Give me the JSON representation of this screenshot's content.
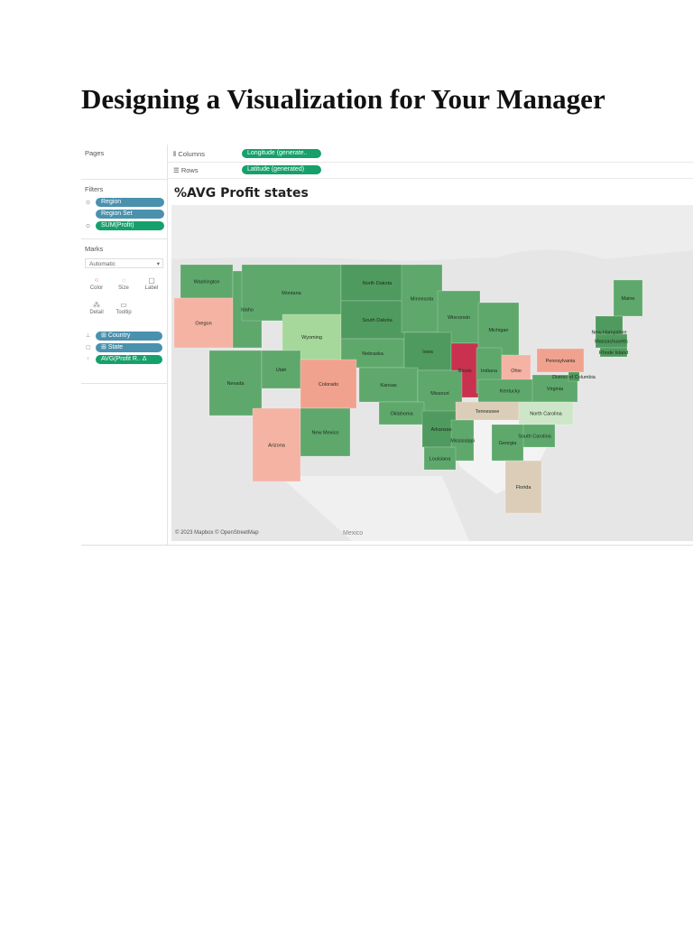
{
  "document": {
    "title": "Designing a Visualization for Your Manager"
  },
  "shelves": {
    "columns": {
      "label": "Columns",
      "icon": "columns-icon",
      "pill": "Longitude (generate.."
    },
    "rows": {
      "label": "Rows",
      "icon": "rows-icon",
      "pill": "Latitude (generated)"
    }
  },
  "pages": {
    "title": "Pages"
  },
  "filters": {
    "title": "Filters",
    "items": [
      "Region",
      "Region Set",
      "SUM(Profit)"
    ]
  },
  "marks": {
    "title": "Marks",
    "type": "Automatic",
    "buttons": [
      "Color",
      "Size",
      "Label",
      "Detail",
      "Tooltip"
    ],
    "fields": [
      "Country",
      "State",
      "AVG(Profit R.."
    ]
  },
  "viz": {
    "title": "%AVG Profit states",
    "credit": "© 2023 Mapbox © OpenStreetMap",
    "basemap_labels": [
      "Mexico"
    ],
    "colors": {
      "dark_green": "#4f9a5e",
      "green": "#5ea86c",
      "light_green": "#a6d79b",
      "pale_green": "#cde6c7",
      "salmon": "#f1a28f",
      "light_salmon": "#f5b3a4",
      "red": "#c9314f",
      "tan": "#dccdb9"
    },
    "states": [
      {
        "name": "Washington",
        "color": "green"
      },
      {
        "name": "Oregon",
        "color": "light_salmon"
      },
      {
        "name": "Idaho",
        "color": "green"
      },
      {
        "name": "Montana",
        "color": "green"
      },
      {
        "name": "Wyoming",
        "color": "light_green"
      },
      {
        "name": "North Dakota",
        "color": "dark_green"
      },
      {
        "name": "South Dakota",
        "color": "dark_green"
      },
      {
        "name": "Minnesota",
        "color": "green"
      },
      {
        "name": "Wisconsin",
        "color": "green"
      },
      {
        "name": "Nebraska",
        "color": "green"
      },
      {
        "name": "Iowa",
        "color": "dark_green"
      },
      {
        "name": "Illinois",
        "color": "red"
      },
      {
        "name": "Michigan",
        "color": "green"
      },
      {
        "name": "Indiana",
        "color": "green"
      },
      {
        "name": "Ohio",
        "color": "light_salmon"
      },
      {
        "name": "Pennsylvania",
        "color": "salmon"
      },
      {
        "name": "Nevada",
        "color": "green"
      },
      {
        "name": "Utah",
        "color": "green"
      },
      {
        "name": "Colorado",
        "color": "salmon"
      },
      {
        "name": "Kansas",
        "color": "green"
      },
      {
        "name": "Missouri",
        "color": "green"
      },
      {
        "name": "Kentucky",
        "color": "green"
      },
      {
        "name": "Virginia",
        "color": "green"
      },
      {
        "name": "District of Columbia",
        "color": "dark_green"
      },
      {
        "name": "Arizona",
        "color": "light_salmon"
      },
      {
        "name": "New Mexico",
        "color": "green"
      },
      {
        "name": "Oklahoma",
        "color": "green"
      },
      {
        "name": "Arkansas",
        "color": "dark_green"
      },
      {
        "name": "Tennessee",
        "color": "tan"
      },
      {
        "name": "North Carolina",
        "color": "pale_green"
      },
      {
        "name": "Mississippi",
        "color": "green"
      },
      {
        "name": "South Carolina",
        "color": "green"
      },
      {
        "name": "Georgia",
        "color": "green"
      },
      {
        "name": "Louisiana",
        "color": "green"
      },
      {
        "name": "Florida",
        "color": "tan"
      },
      {
        "name": "Maine",
        "color": "green"
      },
      {
        "name": "New Hampshire",
        "color": "dark_green"
      },
      {
        "name": "Massachusetts",
        "color": "dark_green"
      },
      {
        "name": "Rhode Island",
        "color": "dark_green"
      }
    ]
  }
}
